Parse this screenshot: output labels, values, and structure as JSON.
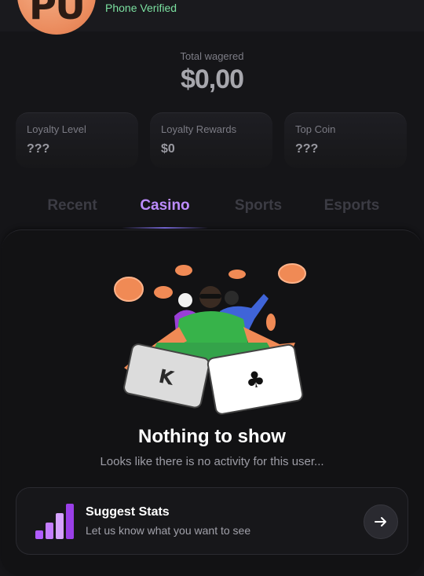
{
  "profile": {
    "initials": "PU",
    "verified_text": "Phone Verified"
  },
  "wagered": {
    "label": "Total wagered",
    "value": "$0,00"
  },
  "stats": [
    {
      "label": "Loyalty Level",
      "value": "???"
    },
    {
      "label": "Loyalty Rewards",
      "value": "$0"
    },
    {
      "label": "Top Coin",
      "value": "???"
    }
  ],
  "tabs": [
    {
      "label": "Recent",
      "active": false
    },
    {
      "label": "Casino",
      "active": true
    },
    {
      "label": "Sports",
      "active": false
    },
    {
      "label": "Esports",
      "active": false
    }
  ],
  "empty_state": {
    "title": "Nothing to show",
    "subtitle": "Looks like there is no activity for this user..."
  },
  "suggest": {
    "title": "Suggest Stats",
    "subtitle": "Let us know what you want to see",
    "icon": "bar-chart-icon",
    "action_icon": "arrow-right-icon"
  },
  "colors": {
    "background": "#151518",
    "accent": "#bd8cff",
    "verified": "#7be0a0",
    "avatar": "#ea8a5c"
  }
}
